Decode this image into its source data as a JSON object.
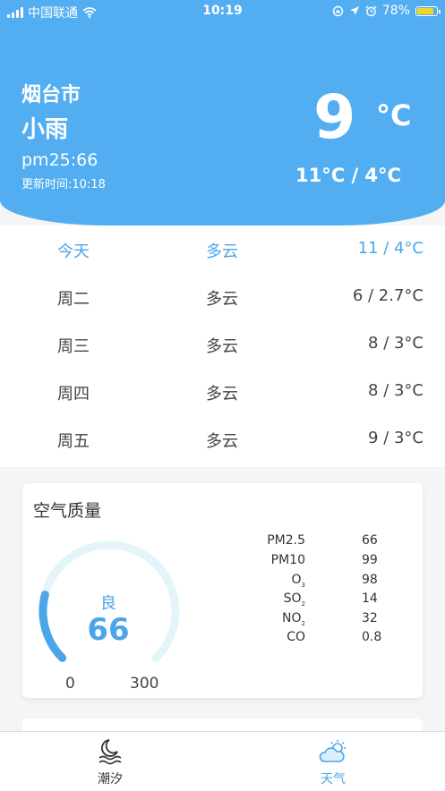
{
  "status_bar": {
    "carrier": "中国联通",
    "time": "10:19",
    "battery": "78%",
    "battery_level": 0.78
  },
  "header": {
    "city": "烟台市",
    "condition": "小雨",
    "pm": "pm25:66",
    "updated": "更新时间:10:18",
    "temperature": "9",
    "unit": "°C",
    "range": "11°C / 4°C"
  },
  "forecast": [
    {
      "day": "今天",
      "condition": "多云",
      "temp": "11 / 4°C"
    },
    {
      "day": "周二",
      "condition": "多云",
      "temp": "6 / 2.7°C"
    },
    {
      "day": "周三",
      "condition": "多云",
      "temp": "8 / 3°C"
    },
    {
      "day": "周四",
      "condition": "多云",
      "temp": "8 / 3°C"
    },
    {
      "day": "周五",
      "condition": "多云",
      "temp": "9 / 3°C"
    }
  ],
  "air_quality": {
    "title": "空气质量",
    "level": "良",
    "value": "66",
    "min": "0",
    "max": "300",
    "gauge_value": 66,
    "gauge_max": 300,
    "pollutants": [
      {
        "name": "PM2.5",
        "sub": "",
        "value": "66"
      },
      {
        "name": "PM10",
        "sub": "",
        "value": "99"
      },
      {
        "name": "O",
        "sub": "3",
        "value": "98"
      },
      {
        "name": "SO",
        "sub": "2",
        "value": "14"
      },
      {
        "name": "NO",
        "sub": "2",
        "value": "32"
      },
      {
        "name": "CO",
        "sub": "",
        "value": "0.8"
      }
    ]
  },
  "tabs": [
    {
      "label": "潮汐",
      "icon": "moon-waves-icon",
      "color": "#333333"
    },
    {
      "label": "天气",
      "icon": "sun-cloud-icon",
      "color": "#4aa6e8"
    }
  ],
  "colors": {
    "accent": "#52aef0",
    "gauge_track": "#e3f5f9",
    "gauge_fill": "#4aa6e8"
  }
}
